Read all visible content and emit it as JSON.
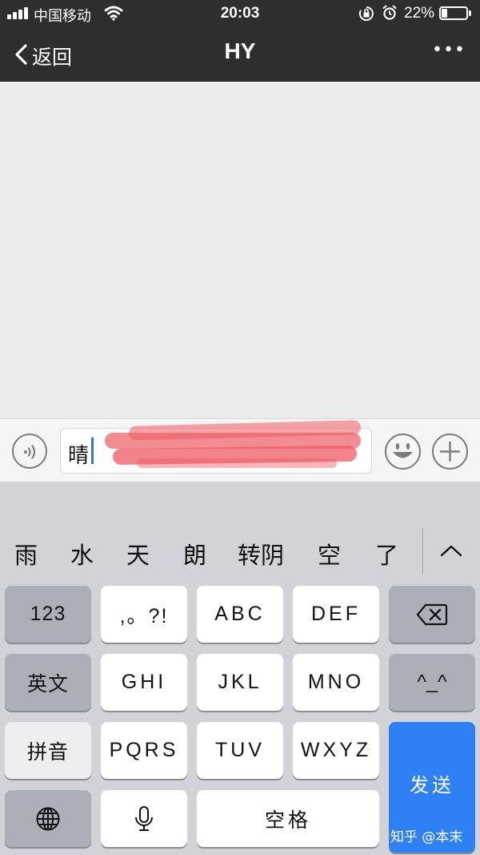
{
  "status": {
    "carrier": "中国移动",
    "time": "20:03",
    "battery": "22%"
  },
  "nav": {
    "back": "返回",
    "title": "HY",
    "more": "•••"
  },
  "input": {
    "text": "晴"
  },
  "candidates": [
    "雨",
    "水",
    "天",
    "朗",
    "转阴",
    "空",
    "了"
  ],
  "keys": {
    "k123": "123",
    "punct": ",。?!",
    "abc": "ABC",
    "def": "DEF",
    "english": "英文",
    "ghi": "GHI",
    "jkl": "JKL",
    "mno": "MNO",
    "face": "^_^",
    "pinyin": "拼音",
    "pqrs": "PQRS",
    "tuv": "TUV",
    "wxyz": "WXYZ",
    "space": "空格",
    "send": "发送"
  },
  "watermark": "知乎 @本末",
  "colors": {
    "bar": "#2e2e30",
    "send": "#2f80f5",
    "keyboard": "#d1d3d9"
  }
}
